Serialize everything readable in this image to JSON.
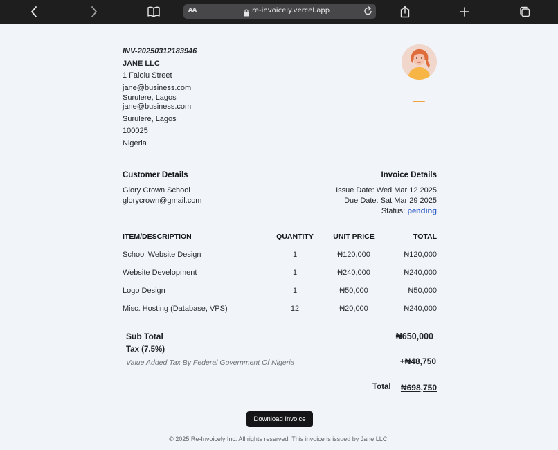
{
  "browser": {
    "text_size_label": "AA",
    "url": "re-invoicely.vercel.app"
  },
  "invoice": {
    "number": "INV-20250312183946",
    "seller": {
      "name": "JANE LLC",
      "street": "1 Falolu Street",
      "email": "jane@business.com",
      "city_clipped": "Surulere, Lagos",
      "email2": "jane@business.com",
      "city": "Surulere, Lagos",
      "postcode": "100025",
      "country": "Nigeria"
    },
    "customer": {
      "title": "Customer Details",
      "name": "Glory Crown School",
      "email": "glorycrown@gmail.com"
    },
    "details": {
      "title": "Invoice Details",
      "issue_date": "Issue Date: Wed Mar 12 2025",
      "due_date": "Due Date: Sat Mar 29 2025",
      "status_label": "Status:",
      "status": "pending"
    },
    "table": {
      "headers": [
        "ITEM/DESCRIPTION",
        "QUANTITY",
        "UNIT PRICE",
        "TOTAL"
      ],
      "rows": [
        [
          "School Website Design",
          "1",
          "₦120,000",
          "₦120,000"
        ],
        [
          "Website Development",
          "1",
          "₦240,000",
          "₦240,000"
        ],
        [
          "Logo Design",
          "1",
          "₦50,000",
          "₦50,000"
        ],
        [
          "Misc. Hosting (Database, VPS)",
          "12",
          "₦20,000",
          "₦240,000"
        ]
      ]
    },
    "summary": {
      "subtotal_label": "Sub Total",
      "subtotal": "₦650,000",
      "tax_label": "Tax (7.5%)",
      "tax_description": "Value Added Tax By Federal Government Of Nigeria",
      "tax_value": "+₦48,750",
      "total_label": "Total",
      "total": "₦698,750"
    }
  },
  "actions": {
    "download_label": "Download Invoice"
  },
  "footer": {
    "text": "© 2025 Re-Invoicely Inc. All rights reserved. This invoice is issued by Jane LLC."
  },
  "colors": {
    "status_pending": "#3461c5",
    "toolbar": "#1e1e1f",
    "button": "#151517"
  }
}
